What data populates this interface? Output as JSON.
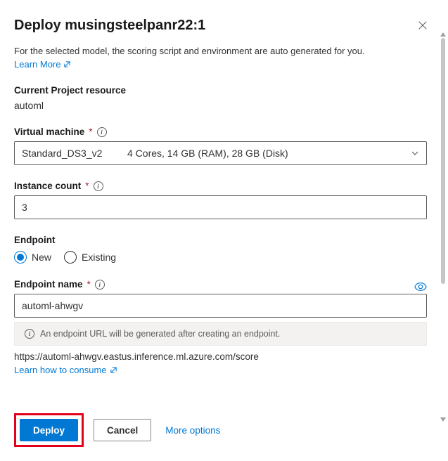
{
  "header": {
    "title": "Deploy musingsteelpanr22:1"
  },
  "intro": {
    "description": "For the selected model, the scoring script and environment are auto generated for you.",
    "learn_more": "Learn More"
  },
  "project": {
    "label": "Current Project resource",
    "value": "automl"
  },
  "vm": {
    "label": "Virtual machine",
    "selected_name": "Standard_DS3_v2",
    "selected_spec": "4 Cores, 14 GB (RAM), 28 GB (Disk)"
  },
  "instance": {
    "label": "Instance count",
    "value": "3"
  },
  "endpoint": {
    "label": "Endpoint",
    "opt_new": "New",
    "opt_existing": "Existing",
    "selected": "new"
  },
  "endpoint_name": {
    "label": "Endpoint name",
    "value": "automl-ahwgv",
    "hint": "An endpoint URL will be generated after creating an endpoint.",
    "url": "https://automl-ahwgv.eastus.inference.ml.azure.com/score",
    "consume_link": "Learn how to consume"
  },
  "footer": {
    "deploy": "Deploy",
    "cancel": "Cancel",
    "more": "More options"
  }
}
